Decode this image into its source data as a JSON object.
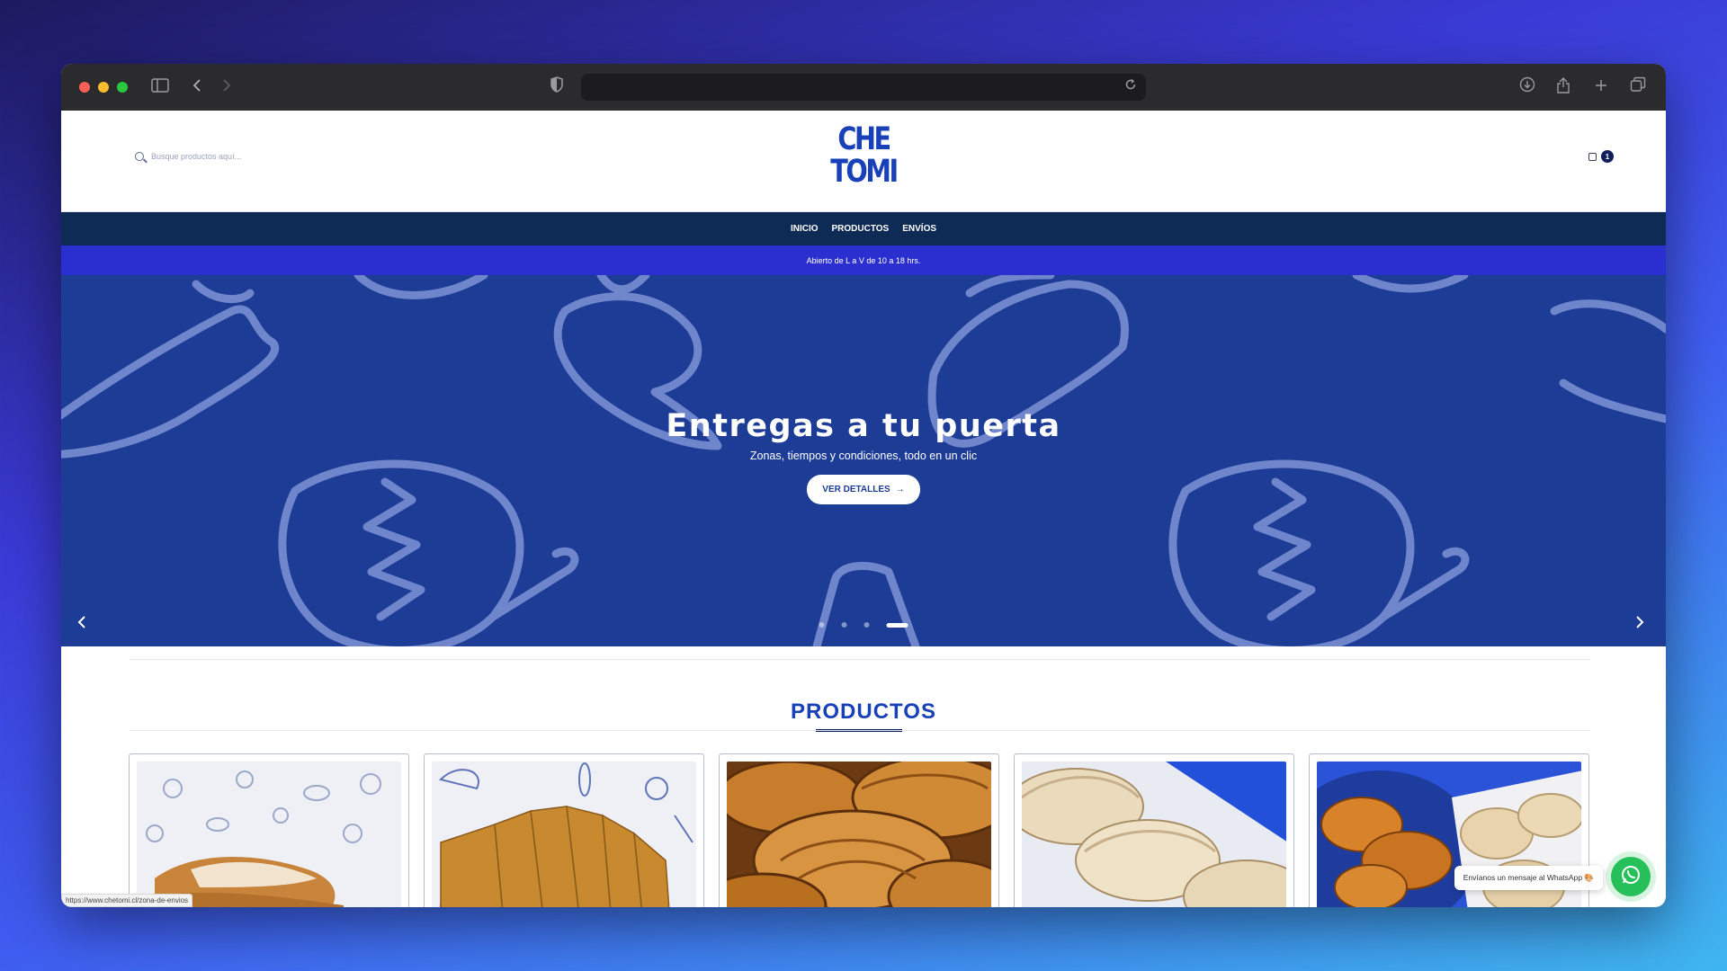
{
  "browser": {
    "traffic_lights": [
      "#fe5f57",
      "#febc2e",
      "#28c840"
    ],
    "icons": [
      "sidebar-icon",
      "back-icon",
      "forward-icon",
      "shield-icon",
      "reload-icon",
      "download-icon",
      "share-icon",
      "new-tab-icon",
      "tabs-icon"
    ]
  },
  "header": {
    "search_placeholder": "Busque productos aquí...",
    "logo_line1": "CHE",
    "logo_line2": "TOMI",
    "cart_count": "1"
  },
  "nav": {
    "items": [
      "INICIO",
      "PRODUCTOS",
      "ENVÍOS"
    ]
  },
  "announcement": "Abierto de L a V de 10 a 18 hrs.",
  "hero": {
    "title": "Entregas a tu puerta",
    "subtitle": "Zonas, tiempos y condiciones, todo en un clic",
    "button_label": "VER DETALLES",
    "slides": 4,
    "active_slide": 4,
    "colors": {
      "background": "#1d3c96",
      "pattern": "#7f93d6"
    }
  },
  "products": {
    "title": "PRODUCTOS",
    "cards": [
      "milanesa",
      "milanesa-cortada",
      "medialunas",
      "empanadas",
      "medialunas-y-empanadas"
    ]
  },
  "status_bar_url": "https://www.chetomi.cl/zona-de-envios",
  "whatsapp": {
    "tooltip": "Envíanos un mensaje al WhatsApp 🎨"
  },
  "colors": {
    "brand_blue": "#1840b8",
    "nav": "#0e2b55",
    "announcement": "#2b2fd0",
    "whatsapp": "#25c05a"
  }
}
